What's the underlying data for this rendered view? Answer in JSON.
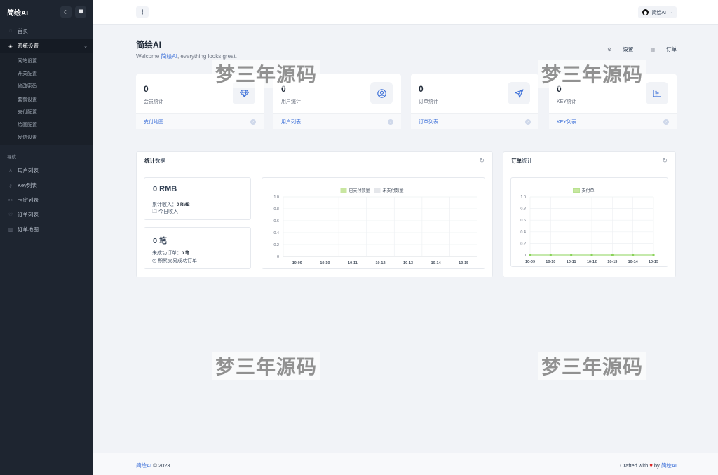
{
  "sidebar": {
    "brand": "简绘AI",
    "theme_icon": "☾",
    "notify_icon": "▾",
    "home": "首页",
    "settings": {
      "label": "系统设置",
      "subitems": [
        "网站设置",
        "开关配置",
        "修改密码",
        "套餐设置",
        "支付配置",
        "绘画配置",
        "发信设置"
      ]
    },
    "section": "导航",
    "nav": [
      {
        "label": "用户列表",
        "icon": "user-icon"
      },
      {
        "label": "Key列表",
        "icon": "key-icon"
      },
      {
        "label": "卡密列表",
        "icon": "ticket-icon"
      },
      {
        "label": "订单列表",
        "icon": "heart-icon"
      },
      {
        "label": "订单地图",
        "icon": "map-icon"
      }
    ]
  },
  "topbar": {
    "menu_icon": "⋮",
    "user": "简绘AI"
  },
  "page": {
    "title": "简绘AI",
    "welcome_prefix": "Welcome ",
    "welcome_name": "简绘AI",
    "welcome_suffix": ", everything looks great.",
    "link_settings": "设置",
    "link_orders": "订单"
  },
  "stats": [
    {
      "value": "0",
      "label": "会员统计",
      "link": "支付地图",
      "icon": "diamond-icon"
    },
    {
      "value": "0",
      "label": "用户统计",
      "link": "用户列表",
      "icon": "user-circle-icon"
    },
    {
      "value": "0",
      "label": "订单统计",
      "link": "订单列表",
      "icon": "send-icon"
    },
    {
      "value": "0",
      "label": "KEY统计",
      "link": "KEY列表",
      "icon": "bar-chart-icon"
    }
  ],
  "stats_panel": {
    "title_bold": "统计",
    "title_rest": "数据",
    "revenue": {
      "value": "0 RMB",
      "line1_label": "累计收入：",
      "line1_value": "0 RMB",
      "line2": "今日收入"
    },
    "orders": {
      "value": "0 笔",
      "line1_label": "未成功订单：",
      "line1_value": "0 笔",
      "line2": "积累交易成功订单"
    }
  },
  "order_panel": {
    "title_bold": "订单",
    "title_rest": "统计"
  },
  "watermark": "梦三年源码",
  "footer": {
    "brand": "简绘AI",
    "year": "© 2023",
    "crafted": "Crafted with",
    "by": "by",
    "author": "简绘AI"
  },
  "colors": {
    "accent": "#3b6fd8",
    "sidebar": "#1e2530",
    "paid": "#c8e6a0",
    "unpaid": "#e5e7eb",
    "line": "#8bd35a"
  },
  "chart_data": [
    {
      "type": "bar",
      "categories": [
        "10-09",
        "10-10",
        "10-11",
        "10-12",
        "10-13",
        "10-14",
        "10-15"
      ],
      "series": [
        {
          "name": "已支付数量",
          "values": [
            0,
            0,
            0,
            0,
            0,
            0,
            0
          ]
        },
        {
          "name": "未支付数量",
          "values": [
            0,
            0,
            0,
            0,
            0,
            0,
            0
          ]
        }
      ],
      "yticks": [
        "0",
        "0.2",
        "0.4",
        "0.6",
        "0.8",
        "1.0"
      ],
      "ylim": [
        0,
        1
      ],
      "legend": "top-center",
      "grid": true
    },
    {
      "type": "line",
      "categories": [
        "10-09",
        "10-10",
        "10-11",
        "10-12",
        "10-13",
        "10-14",
        "10-15"
      ],
      "series": [
        {
          "name": "支付单",
          "values": [
            0,
            0,
            0,
            0,
            0,
            0,
            0
          ]
        }
      ],
      "yticks": [
        "0",
        "0.2",
        "0.4",
        "0.6",
        "0.8",
        "1.0"
      ],
      "ylim": [
        0,
        1
      ],
      "legend": "top-center",
      "grid": true
    }
  ]
}
